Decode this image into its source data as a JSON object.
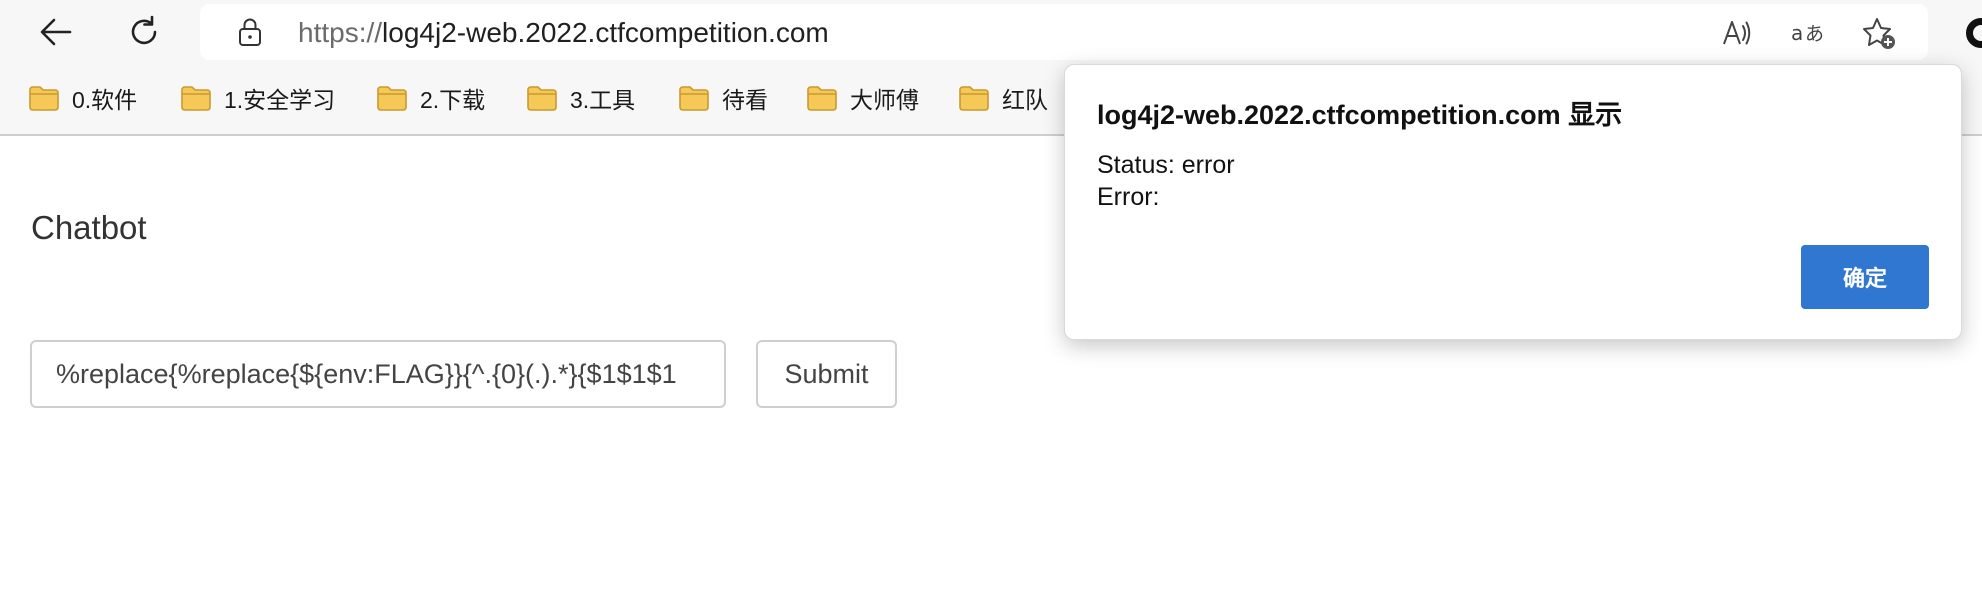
{
  "browser": {
    "url_scheme": "https://",
    "url_host": "log4j2-web.2022.ctfcompetition.com",
    "icons": {
      "back": "arrow-left-icon",
      "reload": "reload-icon",
      "lock": "lock-icon",
      "read_aloud": "read-aloud-icon",
      "translate": "translate-icon",
      "favorite": "add-favorite-icon"
    },
    "bookmarks": [
      {
        "label": "0.软件"
      },
      {
        "label": "1.安全学习"
      },
      {
        "label": "2.下载"
      },
      {
        "label": "3.工具"
      },
      {
        "label": "待看"
      },
      {
        "label": "大师傅"
      },
      {
        "label": "红队"
      }
    ]
  },
  "page": {
    "title": "Chatbot",
    "input_value": "%replace{%replace{${env:FLAG}}{^.{0}(.).*}{$1$1$1",
    "submit_label": "Submit"
  },
  "dialog": {
    "title": "log4j2-web.2022.ctfcompetition.com 显示",
    "status_line": "Status: error",
    "error_line": "Error:",
    "ok_label": "确定",
    "ok_color": "#2f77d1"
  }
}
